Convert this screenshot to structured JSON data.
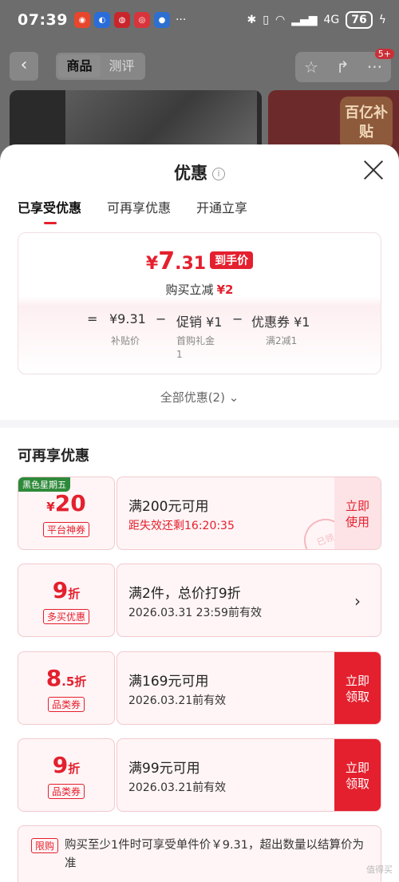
{
  "status_bar": {
    "time": "07:39",
    "battery": "76",
    "net": "4G"
  },
  "topbar": {
    "tabs": [
      "商品",
      "测评"
    ],
    "badge": "5+"
  },
  "banner": {
    "subsidy_text": "百亿补贴"
  },
  "sheet": {
    "title": "优惠",
    "tabs": [
      "已享受优惠",
      "可再享优惠",
      "开通立享"
    ]
  },
  "summary": {
    "yen": "¥",
    "price_int": "7",
    "price_dec": ".31",
    "price_tag": "到手价",
    "reduce_label": "购买立减",
    "reduce_value": "¥2",
    "eq": "=",
    "minus": "−",
    "base_price": "¥9.31",
    "base_label": "补贴价",
    "promo": "促销 ¥1",
    "promo_label": "首购礼金",
    "promo_label2": "1",
    "coupon": "优惠券 ¥1",
    "coupon_label": "满2减1"
  },
  "all_discounts": "全部优惠(2)",
  "section_title": "可再享优惠",
  "coupons": [
    {
      "tag": "黑色星期五",
      "amount_prefix": "¥",
      "amount": "20",
      "amount_suffix": "",
      "label": "平台神券",
      "condition": "满200元可用",
      "sub": "距失效还剩16:20:35",
      "action": "立即\n使用",
      "action1": "立即",
      "action2": "使用",
      "stamp": "已领"
    },
    {
      "amount": "9",
      "amount_suffix": "折",
      "label": "多买优惠",
      "condition": "满2件，总价打9折",
      "sub": "2026.03.31 23:59前有效",
      "action": "›"
    },
    {
      "amount": "8",
      "amount_suffix": ".5折",
      "label": "品类券",
      "condition": "满169元可用",
      "sub": "2026.03.21前有效",
      "action1": "立即",
      "action2": "领取"
    },
    {
      "amount": "9",
      "amount_suffix": "折",
      "label": "品类券",
      "condition": "满99元可用",
      "sub": "2026.03.21前有效",
      "action1": "立即",
      "action2": "领取"
    }
  ],
  "limit": {
    "tag": "限购",
    "text": "购买至少1件时可享受单件价￥9.31，超出数量以结算价为准"
  },
  "colors": {
    "accent": "#e4202e",
    "tag_green": "#2e8a3a"
  },
  "watermark": "值得买"
}
